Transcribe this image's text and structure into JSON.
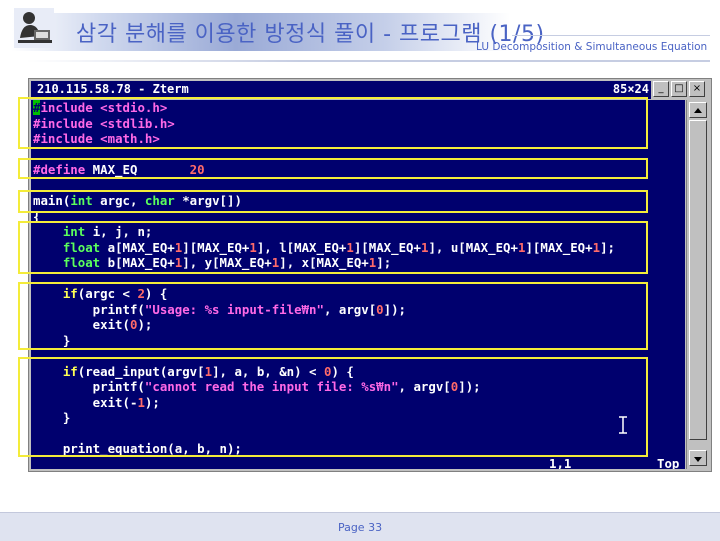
{
  "slide": {
    "title": "삼각 분해를 이용한 방정식 풀이 - 프로그램 (1/5)",
    "subtitle": "LU Decomposition & Simultaneous Equation",
    "page": "Page 33"
  },
  "xterm": {
    "title": "210.115.58.78 - Zterm",
    "size": "85×24",
    "status_position": "1,1",
    "status_scroll": "Top"
  },
  "code": [
    [
      [
        "pre",
        "#include"
      ],
      [
        "txt",
        " "
      ],
      [
        "pre",
        "<stdio.h>"
      ]
    ],
    [
      [
        "pre",
        "#include"
      ],
      [
        "txt",
        " "
      ],
      [
        "pre",
        "<stdlib.h>"
      ]
    ],
    [
      [
        "pre",
        "#include"
      ],
      [
        "txt",
        " "
      ],
      [
        "pre",
        "<math.h>"
      ]
    ],
    [
      [
        "txt",
        ""
      ]
    ],
    [
      [
        "pre",
        "#define"
      ],
      [
        "txt",
        " MAX_EQ       "
      ],
      [
        "num",
        "20"
      ]
    ],
    [
      [
        "txt",
        ""
      ]
    ],
    [
      [
        "txt",
        "main("
      ],
      [
        "type",
        "int"
      ],
      [
        "txt",
        " argc, "
      ],
      [
        "type",
        "char"
      ],
      [
        "txt",
        " *argv[])"
      ]
    ],
    [
      [
        "txt",
        "{"
      ]
    ],
    [
      [
        "txt",
        "    "
      ],
      [
        "type",
        "int"
      ],
      [
        "txt",
        " i, j, n;"
      ]
    ],
    [
      [
        "txt",
        "    "
      ],
      [
        "type",
        "float"
      ],
      [
        "txt",
        " a[MAX_EQ+"
      ],
      [
        "num",
        "1"
      ],
      [
        "txt",
        "][MAX_EQ+"
      ],
      [
        "num",
        "1"
      ],
      [
        "txt",
        "], l[MAX_EQ+"
      ],
      [
        "num",
        "1"
      ],
      [
        "txt",
        "][MAX_EQ+"
      ],
      [
        "num",
        "1"
      ],
      [
        "txt",
        "], u[MAX_EQ+"
      ],
      [
        "num",
        "1"
      ],
      [
        "txt",
        "][MAX_EQ+"
      ],
      [
        "num",
        "1"
      ],
      [
        "txt",
        "];"
      ]
    ],
    [
      [
        "txt",
        "    "
      ],
      [
        "type",
        "float"
      ],
      [
        "txt",
        " b[MAX_EQ+"
      ],
      [
        "num",
        "1"
      ],
      [
        "txt",
        "], y[MAX_EQ+"
      ],
      [
        "num",
        "1"
      ],
      [
        "txt",
        "], x[MAX_EQ+"
      ],
      [
        "num",
        "1"
      ],
      [
        "txt",
        "];"
      ]
    ],
    [
      [
        "txt",
        ""
      ]
    ],
    [
      [
        "txt",
        "    "
      ],
      [
        "ctrl",
        "if"
      ],
      [
        "txt",
        "(argc < "
      ],
      [
        "num",
        "2"
      ],
      [
        "txt",
        ") {"
      ]
    ],
    [
      [
        "txt",
        "        printf("
      ],
      [
        "str",
        "\"Usage: %s input-file₩n\""
      ],
      [
        "txt",
        ", argv["
      ],
      [
        "num",
        "0"
      ],
      [
        "txt",
        "]);"
      ]
    ],
    [
      [
        "txt",
        "        exit("
      ],
      [
        "num",
        "0"
      ],
      [
        "txt",
        ");"
      ]
    ],
    [
      [
        "txt",
        "    }"
      ]
    ],
    [
      [
        "txt",
        ""
      ]
    ],
    [
      [
        "txt",
        "    "
      ],
      [
        "ctrl",
        "if"
      ],
      [
        "txt",
        "(read_input(argv["
      ],
      [
        "num",
        "1"
      ],
      [
        "txt",
        "], a, b, &n) < "
      ],
      [
        "num",
        "0"
      ],
      [
        "txt",
        ") {"
      ]
    ],
    [
      [
        "txt",
        "        printf("
      ],
      [
        "str",
        "\"cannot read the input file: %s₩n\""
      ],
      [
        "txt",
        ", argv["
      ],
      [
        "num",
        "0"
      ],
      [
        "txt",
        "]);"
      ]
    ],
    [
      [
        "txt",
        "        exit(-"
      ],
      [
        "num",
        "1"
      ],
      [
        "txt",
        ");"
      ]
    ],
    [
      [
        "txt",
        "    }"
      ]
    ],
    [
      [
        "txt",
        ""
      ]
    ],
    [
      [
        "txt",
        "    print_equation(a, b, n);"
      ]
    ]
  ],
  "colors": {
    "terminal_bg": "#00006e",
    "highlight_box": "#f4ec3a",
    "title_text": "#4a63c4",
    "preprocessor": "#ff69e6",
    "type_keyword": "#5cff5c",
    "control_keyword": "#ffff55",
    "number": "#ff6a6a"
  },
  "icons": {
    "logo": "person-at-desk-icon",
    "scroll_up": "arrow-up-icon",
    "scroll_down": "arrow-down-icon",
    "cursor": "i-beam-cursor-icon"
  }
}
